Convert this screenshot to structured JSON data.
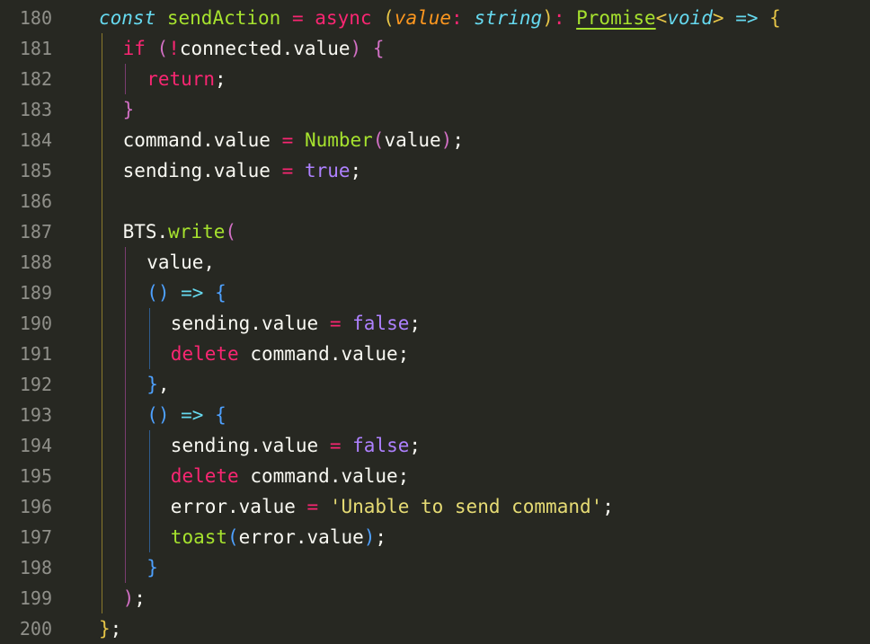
{
  "colors": {
    "background": "#272822",
    "gutter_text": "#90908a",
    "default": "#f8f8f2",
    "keyword_cyan": "#66d9ef",
    "function_green": "#a6e22e",
    "operator_pink": "#f92672",
    "param_orange": "#fd971f",
    "constant_purple": "#ae81ff",
    "string_yellow": "#e6db74",
    "bracket_gold": "#e6c547",
    "bracket_pink": "#d270c5",
    "bracket_blue": "#4ea1ff",
    "guide_gold": "#8a7a2c",
    "guide_pink": "#7a3d70",
    "guide_blue": "#2f5c8f"
  },
  "lines": [
    {
      "num": "180",
      "indent": 0,
      "tokens": [
        {
          "t": "const",
          "c": "keyword_cyan",
          "i": true
        },
        {
          "t": " "
        },
        {
          "t": "sendAction",
          "c": "function_green"
        },
        {
          "t": " "
        },
        {
          "t": "=",
          "c": "operator_pink"
        },
        {
          "t": " "
        },
        {
          "t": "async",
          "c": "operator_pink"
        },
        {
          "t": " "
        },
        {
          "t": "(",
          "c": "bracket_gold"
        },
        {
          "t": "value",
          "c": "param_orange",
          "i": true
        },
        {
          "t": ": ",
          "c": "operator_pink"
        },
        {
          "t": "string",
          "c": "keyword_cyan",
          "i": true
        },
        {
          "t": ")",
          "c": "bracket_gold"
        },
        {
          "t": ": ",
          "c": "operator_pink"
        },
        {
          "t": "Promise",
          "c": "function_green",
          "u": true
        },
        {
          "t": "<",
          "c": "bracket_gold"
        },
        {
          "t": "void",
          "c": "keyword_cyan",
          "i": true
        },
        {
          "t": ">",
          "c": "bracket_gold"
        },
        {
          "t": " "
        },
        {
          "t": "=>",
          "c": "keyword_cyan"
        },
        {
          "t": " "
        },
        {
          "t": "{",
          "c": "bracket_gold"
        }
      ]
    },
    {
      "num": "181",
      "indent": 1,
      "tokens": [
        {
          "t": "if",
          "c": "operator_pink"
        },
        {
          "t": " "
        },
        {
          "t": "(",
          "c": "bracket_pink"
        },
        {
          "t": "!",
          "c": "operator_pink"
        },
        {
          "t": "connected.value"
        },
        {
          "t": ")",
          "c": "bracket_pink"
        },
        {
          "t": " "
        },
        {
          "t": "{",
          "c": "bracket_pink"
        }
      ]
    },
    {
      "num": "182",
      "indent": 2,
      "tokens": [
        {
          "t": "return",
          "c": "operator_pink"
        },
        {
          "t": ";"
        }
      ]
    },
    {
      "num": "183",
      "indent": 1,
      "tokens": [
        {
          "t": "}",
          "c": "bracket_pink"
        }
      ]
    },
    {
      "num": "184",
      "indent": 1,
      "tokens": [
        {
          "t": "command.value"
        },
        {
          "t": " "
        },
        {
          "t": "=",
          "c": "operator_pink"
        },
        {
          "t": " "
        },
        {
          "t": "Number",
          "c": "function_green"
        },
        {
          "t": "(",
          "c": "bracket_pink"
        },
        {
          "t": "value"
        },
        {
          "t": ")",
          "c": "bracket_pink"
        },
        {
          "t": ";"
        }
      ]
    },
    {
      "num": "185",
      "indent": 1,
      "tokens": [
        {
          "t": "sending.value"
        },
        {
          "t": " "
        },
        {
          "t": "=",
          "c": "operator_pink"
        },
        {
          "t": " "
        },
        {
          "t": "true",
          "c": "constant_purple"
        },
        {
          "t": ";"
        }
      ]
    },
    {
      "num": "186",
      "indent": 1,
      "tokens": []
    },
    {
      "num": "187",
      "indent": 1,
      "tokens": [
        {
          "t": "BTS."
        },
        {
          "t": "write",
          "c": "function_green"
        },
        {
          "t": "(",
          "c": "bracket_pink"
        }
      ]
    },
    {
      "num": "188",
      "indent": 2,
      "tokens": [
        {
          "t": "value,"
        }
      ]
    },
    {
      "num": "189",
      "indent": 2,
      "tokens": [
        {
          "t": "()",
          "c": "bracket_blue"
        },
        {
          "t": " "
        },
        {
          "t": "=>",
          "c": "keyword_cyan"
        },
        {
          "t": " "
        },
        {
          "t": "{",
          "c": "bracket_blue"
        }
      ]
    },
    {
      "num": "190",
      "indent": 3,
      "tokens": [
        {
          "t": "sending.value"
        },
        {
          "t": " "
        },
        {
          "t": "=",
          "c": "operator_pink"
        },
        {
          "t": " "
        },
        {
          "t": "false",
          "c": "constant_purple"
        },
        {
          "t": ";"
        }
      ]
    },
    {
      "num": "191",
      "indent": 3,
      "tokens": [
        {
          "t": "delete",
          "c": "operator_pink"
        },
        {
          "t": " "
        },
        {
          "t": "command.value;"
        }
      ]
    },
    {
      "num": "192",
      "indent": 2,
      "tokens": [
        {
          "t": "}",
          "c": "bracket_blue"
        },
        {
          "t": ","
        }
      ]
    },
    {
      "num": "193",
      "indent": 2,
      "tokens": [
        {
          "t": "()",
          "c": "bracket_blue"
        },
        {
          "t": " "
        },
        {
          "t": "=>",
          "c": "keyword_cyan"
        },
        {
          "t": " "
        },
        {
          "t": "{",
          "c": "bracket_blue"
        }
      ]
    },
    {
      "num": "194",
      "indent": 3,
      "tokens": [
        {
          "t": "sending.value"
        },
        {
          "t": " "
        },
        {
          "t": "=",
          "c": "operator_pink"
        },
        {
          "t": " "
        },
        {
          "t": "false",
          "c": "constant_purple"
        },
        {
          "t": ";"
        }
      ]
    },
    {
      "num": "195",
      "indent": 3,
      "tokens": [
        {
          "t": "delete",
          "c": "operator_pink"
        },
        {
          "t": " "
        },
        {
          "t": "command.value;"
        }
      ]
    },
    {
      "num": "196",
      "indent": 3,
      "tokens": [
        {
          "t": "error.value"
        },
        {
          "t": " "
        },
        {
          "t": "=",
          "c": "operator_pink"
        },
        {
          "t": " "
        },
        {
          "t": "'Unable to send command'",
          "c": "string_yellow"
        },
        {
          "t": ";"
        }
      ]
    },
    {
      "num": "197",
      "indent": 3,
      "tokens": [
        {
          "t": "toast",
          "c": "function_green"
        },
        {
          "t": "(",
          "c": "bracket_blue"
        },
        {
          "t": "error.value"
        },
        {
          "t": ")",
          "c": "bracket_blue"
        },
        {
          "t": ";"
        }
      ]
    },
    {
      "num": "198",
      "indent": 2,
      "tokens": [
        {
          "t": "}",
          "c": "bracket_blue"
        }
      ]
    },
    {
      "num": "199",
      "indent": 1,
      "tokens": [
        {
          "t": ")",
          "c": "bracket_pink"
        },
        {
          "t": ";"
        }
      ]
    },
    {
      "num": "200",
      "indent": 0,
      "tokens": [
        {
          "t": "}",
          "c": "bracket_gold"
        },
        {
          "t": ";"
        }
      ]
    }
  ]
}
